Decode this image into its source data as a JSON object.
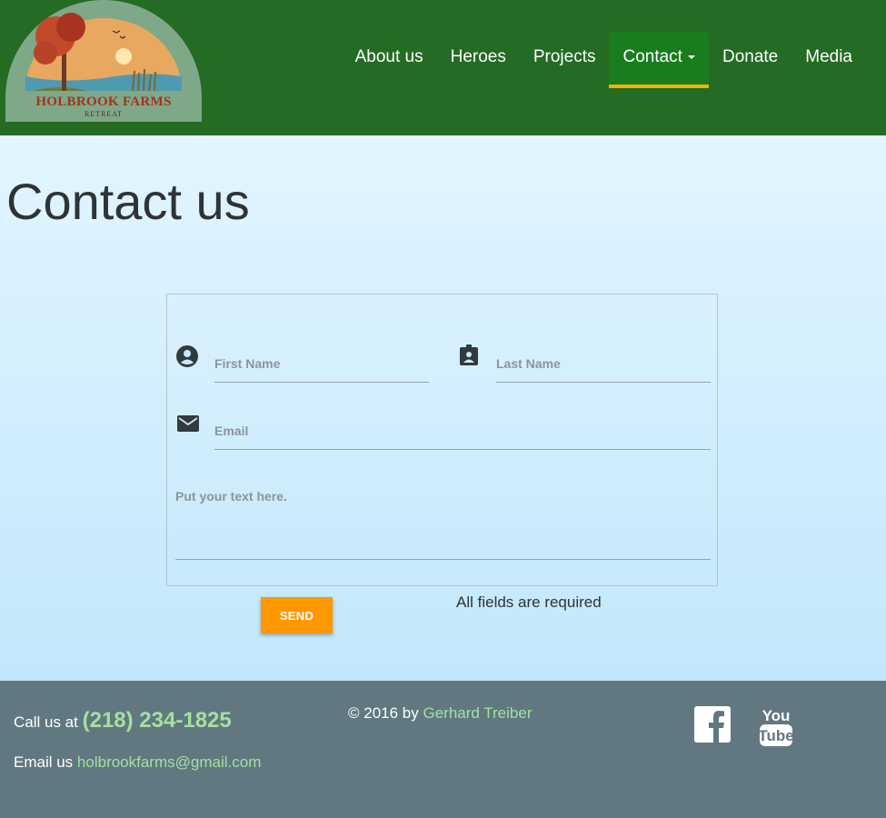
{
  "brand": {
    "logo_text": "HOLBROOK FARMS",
    "logo_subtext": "RETREAT"
  },
  "nav": {
    "items": [
      {
        "label": "About us"
      },
      {
        "label": "Heroes"
      },
      {
        "label": "Projects"
      },
      {
        "label": "Contact"
      },
      {
        "label": "Donate"
      },
      {
        "label": "Media"
      }
    ],
    "active": "Contact"
  },
  "page": {
    "title": "Contact us"
  },
  "form": {
    "first_name_placeholder": "First Name",
    "last_name_placeholder": "Last Name",
    "email_placeholder": "Email",
    "message_placeholder": "Put your text here.",
    "send_label": "SEND",
    "required_note": "All fields are required"
  },
  "footer": {
    "call_prefix": "Call us at",
    "phone": "(218) 234-1825",
    "email_prefix": "Email us",
    "email": "holbrookfarms@gmail.com",
    "copyright_prefix": "© 2016 by",
    "author": "Gerhard Treiber",
    "social": [
      "facebook-icon",
      "youtube-icon"
    ]
  },
  "colors": {
    "header_bg": "#246b24",
    "nav_active_bg": "#197d1e",
    "nav_active_underline": "#f0b400",
    "send_button": "#ff9800",
    "footer_bg": "#617880",
    "footer_link": "#a4e0a0"
  }
}
